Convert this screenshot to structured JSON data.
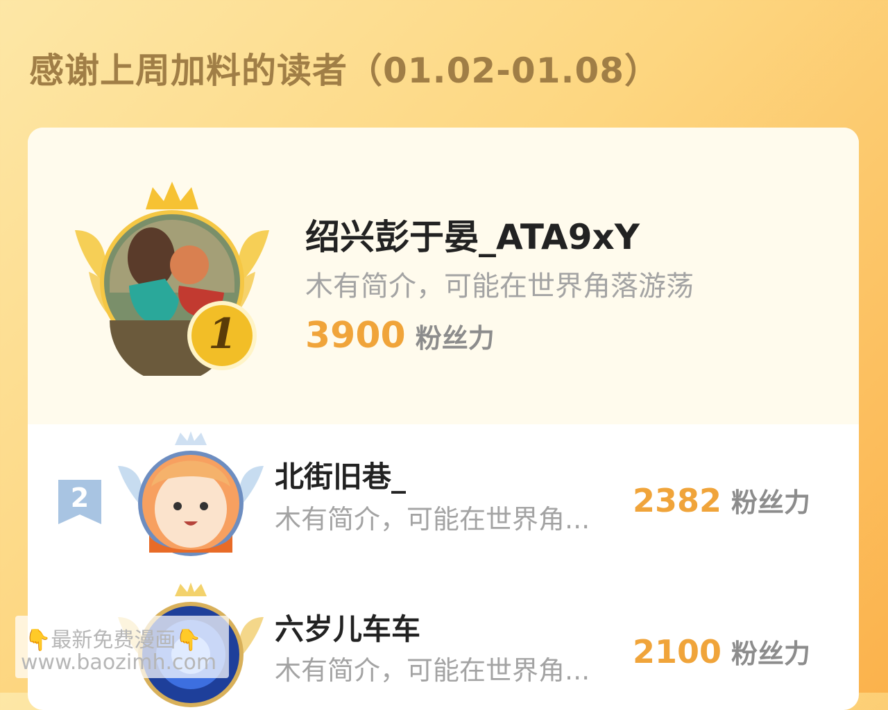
{
  "header": {
    "title": "感谢上周加料的读者（01.02-01.08）"
  },
  "colors": {
    "accent": "#f0a43a",
    "gold": "#f6c233",
    "silver": "#9ebfe0"
  },
  "top_reader": {
    "rank": "1",
    "name": "绍兴彭于晏_ATA9xY",
    "bio": "木有简介，可能在世界角落游荡",
    "score": "3900",
    "score_unit": "粉丝力"
  },
  "readers": [
    {
      "rank": "2",
      "name": "北街旧巷_",
      "bio": "木有简介，可能在世界角...",
      "score": "2382",
      "score_unit": "粉丝力"
    },
    {
      "rank": "",
      "name": "六岁儿车车",
      "bio": "木有简介，可能在世界角...",
      "score": "2100",
      "score_unit": "粉丝力"
    }
  ],
  "watermark": {
    "line1": "最新免费漫画",
    "line2": "www.baozimh.com",
    "hand": "👇"
  }
}
